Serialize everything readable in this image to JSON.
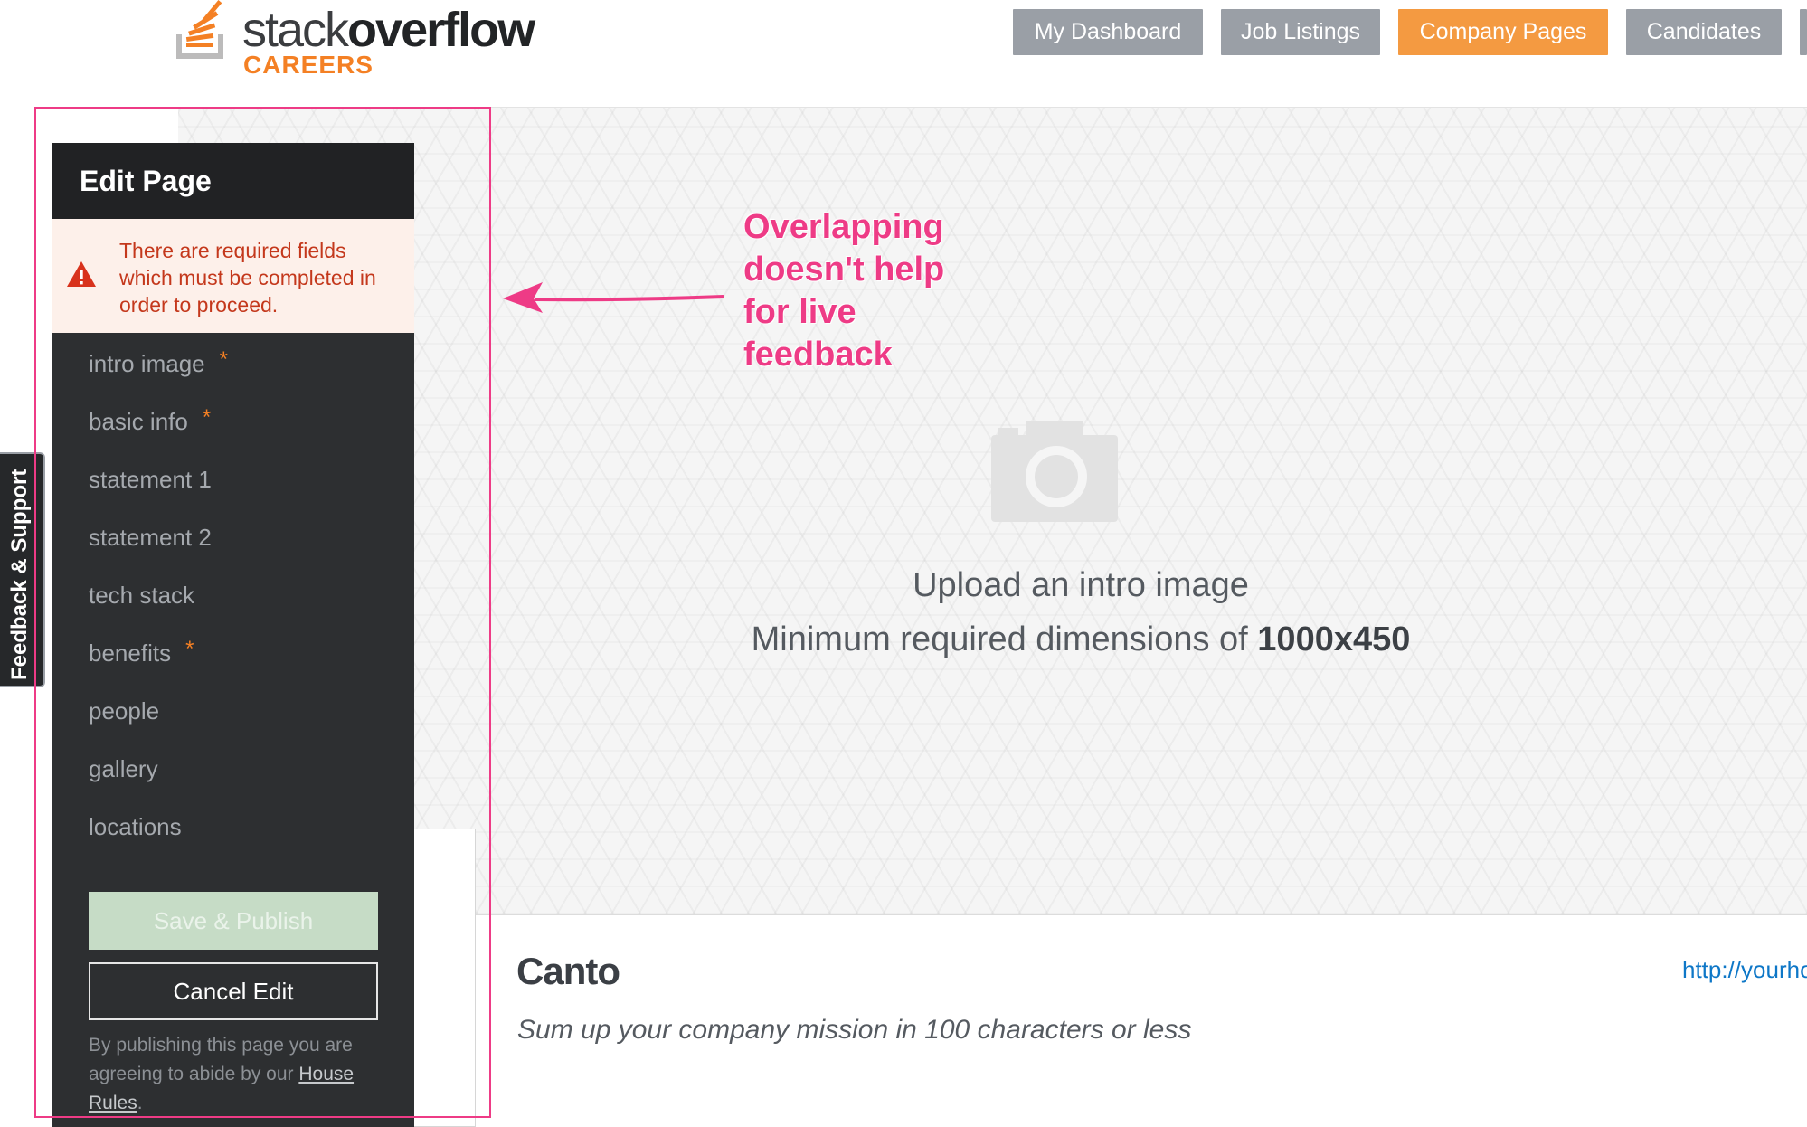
{
  "header": {
    "logo_word_light": "stack",
    "logo_word_bold": "overflow",
    "logo_sub": "CAREERS",
    "nav": [
      "My Dashboard",
      "Job Listings",
      "Company Pages",
      "Candidates"
    ]
  },
  "sidebar": {
    "title": "Edit Page",
    "alert": "There are required fields which must be completed in order to proceed.",
    "items": [
      {
        "label": "intro image",
        "required": "*"
      },
      {
        "label": "basic info",
        "required": "*"
      },
      {
        "label": "statement 1"
      },
      {
        "label": "statement 2"
      },
      {
        "label": "tech stack"
      },
      {
        "label": "benefits",
        "required": "*"
      },
      {
        "label": "people"
      },
      {
        "label": "gallery"
      },
      {
        "label": "locations"
      }
    ],
    "save_label": "Save & Publish",
    "cancel_label": "Cancel Edit",
    "terms_prefix": "By publishing this page you are agreeing to abide by our",
    "terms_link": "House Rules",
    "terms_suffix": "."
  },
  "feedback_tab": "Feedback & Support",
  "banner": {
    "upload_title": "Upload an intro image",
    "upload_dims_prefix": "Minimum required dimensions of",
    "upload_dims_value": "1000x450"
  },
  "company": {
    "name": "Canto",
    "mission_placeholder": "Sum up your company mission in 100 characters or less",
    "url": "http://yourho"
  },
  "annotation": {
    "lines": [
      "Overlapping",
      "doesn't help",
      "for live",
      "feedback"
    ]
  },
  "colors": {
    "accent": "#f48024",
    "annotation": "#ee3b86",
    "alert_text": "#c4381c"
  }
}
